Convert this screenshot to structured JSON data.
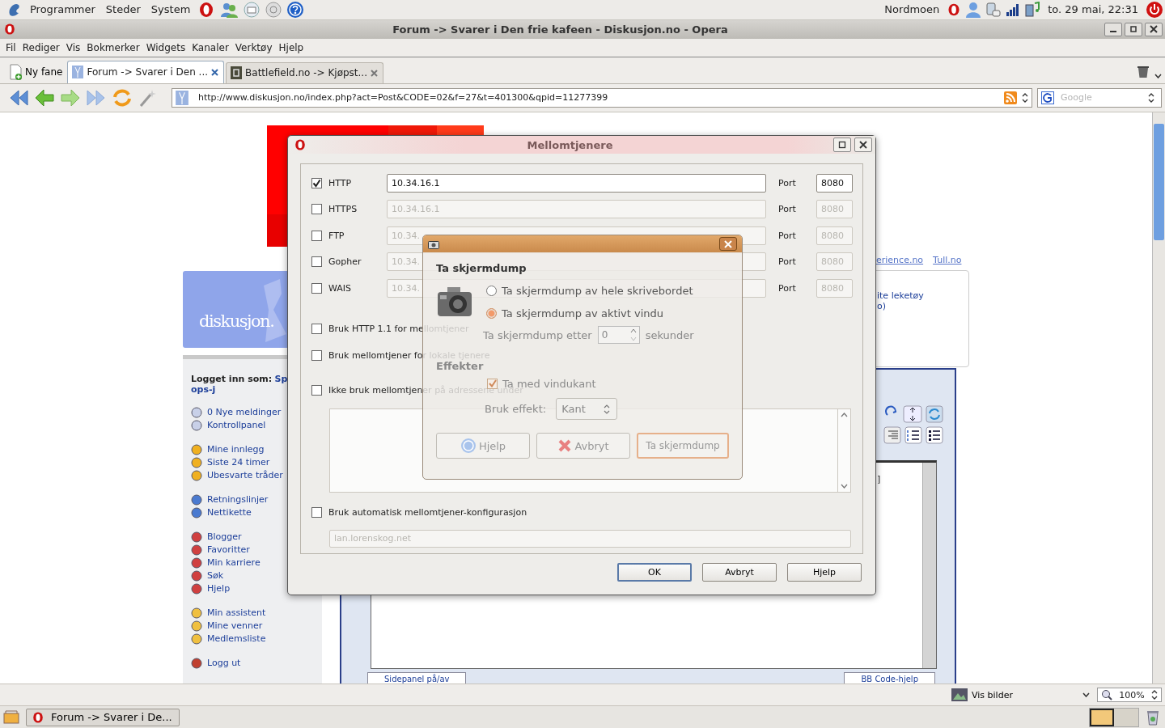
{
  "top_panel": {
    "menus": [
      "Programmer",
      "Steder",
      "System"
    ],
    "location": "Nordmoen",
    "clock": "to. 29 mai, 22:31"
  },
  "window": {
    "title": "Forum -> Svarer i Den frie kafeen - Diskusjon.no - Opera"
  },
  "menu_bar": [
    "Fil",
    "Rediger",
    "Vis",
    "Bokmerker",
    "Widgets",
    "Kanaler",
    "Verktøy",
    "Hjelp"
  ],
  "new_tab": "Ny fane",
  "tabs": [
    {
      "label": "Forum -> Svarer i Den ...",
      "selected": true
    },
    {
      "label": "Battlefield.no -> Kjøpst...",
      "selected": false
    }
  ],
  "address_bar": {
    "url": "http://www.diskusjon.no/index.php?act=Post&CODE=02&f=27&t=401300&qpid=11277399",
    "search_placeholder": "Google"
  },
  "page": {
    "logo": "diskusjon.",
    "logged_in_label": "Logget inn som:",
    "user": "Sp",
    "user_continued": "ops-j",
    "link_groups": [
      [
        "0 Nye meldinger",
        "Kontrollpanel"
      ],
      [
        "Mine innlegg",
        "Siste 24 timer",
        "Ubesvarte tråder"
      ],
      [
        "Retningslinjer",
        "Nettikette"
      ],
      [
        "Blogger",
        "Favoritter",
        "Min karriere",
        "Søk",
        "Hjelp"
      ],
      [
        "Min assistent",
        "Mine venner",
        "Medlemsliste"
      ],
      [
        "Logg ut"
      ]
    ],
    "top_links": [
      "erience.no",
      "Tull.no"
    ],
    "box_lines": [
      "ite leketøy",
      "o)"
    ],
    "editor_fragment": "]",
    "editor_buttons": [
      "Sidepanel på/av",
      "BB Code-hjelp"
    ]
  },
  "proxy_dialog": {
    "title": "Mellomtjenere",
    "protocols": [
      {
        "label": "HTTP",
        "checked": true,
        "host": "10.34.16.1",
        "port_label": "Port",
        "port": "8080"
      },
      {
        "label": "HTTPS",
        "checked": false,
        "host": "10.34.16.1",
        "port_label": "Port",
        "port": "8080"
      },
      {
        "label": "FTP",
        "checked": false,
        "host": "10.34.",
        "port_label": "Port",
        "port": "8080"
      },
      {
        "label": "Gopher",
        "checked": false,
        "host": "10.34.",
        "port_label": "Port",
        "port": "8080"
      },
      {
        "label": "WAIS",
        "checked": false,
        "host": "10.34.",
        "port_label": "Port",
        "port": "8080"
      }
    ],
    "options": [
      {
        "label": "Bruk HTTP 1.1 for mellomtjener",
        "checked": false
      },
      {
        "label": "Bruk mellomtjener for lokale tjenere",
        "checked": false
      },
      {
        "label": "Ikke bruk mellomtjener på adressene under",
        "checked": false
      }
    ],
    "auto": {
      "label": "Bruk automatisk mellomtjener-konfigurasjon",
      "checked": false,
      "url": "lan.lorenskog.net"
    },
    "buttons": [
      "OK",
      "Avbryt",
      "Hjelp"
    ]
  },
  "screenshot_dialog": {
    "heading": "Ta skjermdump",
    "modes": [
      {
        "label": "Ta skjermdump av hele skrivebordet",
        "selected": false
      },
      {
        "label": "Ta skjermdump av aktivt vindu",
        "selected": true
      }
    ],
    "delay_label": "Ta skjermdump etter",
    "delay": "0",
    "delay_unit": "sekunder",
    "effects_heading": "Effekter",
    "border_option": {
      "label": "Ta med vindukant",
      "checked": true
    },
    "effect_label": "Bruk effekt:",
    "effect": "Kant",
    "buttons": [
      "Hjelp",
      "Avbryt",
      "Ta skjermdump"
    ]
  },
  "status_bar": {
    "images": "Vis bilder",
    "zoom": "100%"
  },
  "taskbar": {
    "window": "Forum -> Svarer i De..."
  }
}
